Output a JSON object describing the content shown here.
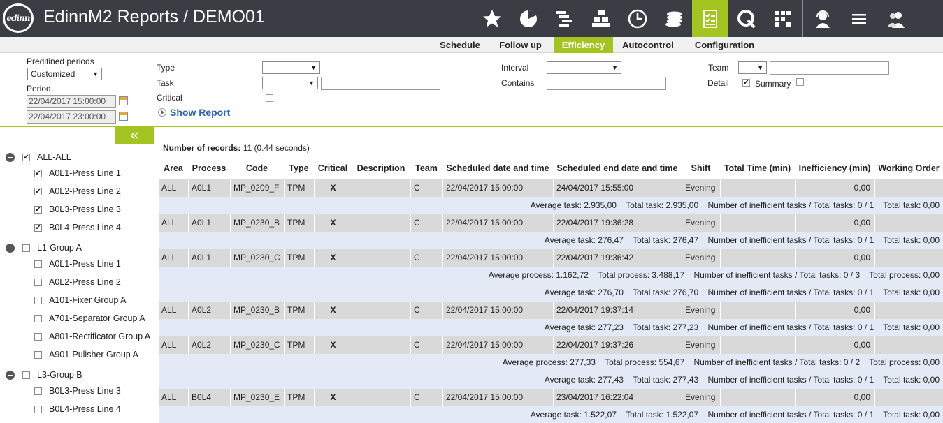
{
  "header": {
    "logo_text": "edinn",
    "title": "EdinnM2 Reports / DEMO01",
    "icons": [
      "star-icon",
      "pie-chart-icon",
      "gantt-icon",
      "stack-icon",
      "clock-icon",
      "coins-icon",
      "checklist-icon",
      "quality-q-icon",
      "grid-dots-icon",
      "support-agent-icon",
      "menu-icon",
      "users-icon"
    ],
    "active_icon": "checklist-icon",
    "accent_color": "#a4c520"
  },
  "tabs": [
    "Schedule",
    "Follow up",
    "Efficiency",
    "Autocontrol",
    "Configuration"
  ],
  "active_tab": "Efficiency",
  "filters": {
    "predefined_periods_label": "Predifined periods",
    "predefined_periods_value": "Customized",
    "period_label": "Period",
    "period_start": "22/04/2017 15:00:00",
    "period_end": "22/04/2017 23:00:00",
    "type_label": "Type",
    "task_label": "Task",
    "critical_label": "Critical",
    "interval_label": "Interval",
    "contains_label": "Contains",
    "team_label": "Team",
    "detail_label": "Detail",
    "summary_label": "Summary",
    "detail_checked": true,
    "summary_checked": false,
    "show_report": "Show Report"
  },
  "sidebar": {
    "collapse_glyph": "«",
    "tree": [
      {
        "label": "ALL-ALL",
        "level": 0,
        "checked": true,
        "group": true
      },
      {
        "label": "A0L1-Press Line 1",
        "level": 1,
        "checked": true
      },
      {
        "label": "A0L2-Press Line 2",
        "level": 1,
        "checked": true
      },
      {
        "label": "B0L3-Press Line 3",
        "level": 1,
        "checked": true
      },
      {
        "label": "B0L4-Press Line 4",
        "level": 1,
        "checked": true
      },
      {
        "label": "L1-Group A",
        "level": 0,
        "checked": false,
        "group": true
      },
      {
        "label": "A0L1-Press Line 1",
        "level": 1,
        "checked": false
      },
      {
        "label": "A0L2-Press Line 2",
        "level": 1,
        "checked": false
      },
      {
        "label": "A101-Fixer Group A",
        "level": 1,
        "checked": false
      },
      {
        "label": "A701-Separator Group A",
        "level": 1,
        "checked": false
      },
      {
        "label": "A801-Rectificator Group A",
        "level": 1,
        "checked": false
      },
      {
        "label": "A901-Pulisher Group A",
        "level": 1,
        "checked": false
      },
      {
        "label": "L3-Group B",
        "level": 0,
        "checked": false,
        "group": true
      },
      {
        "label": "B0L3-Press Line 3",
        "level": 1,
        "checked": false
      },
      {
        "label": "B0L4-Press Line 4",
        "level": 1,
        "checked": false
      }
    ]
  },
  "report": {
    "records_label": "Number of records:",
    "records_value": "11  (0.44 seconds)",
    "columns": [
      "Area",
      "Process",
      "Code",
      "Type",
      "Critical",
      "Description",
      "Team",
      "Scheduled date and time",
      "Scheduled end date and time",
      "Shift",
      "Total Time (min)",
      "Inefficiency (min)",
      "Working Order"
    ],
    "rows": [
      {
        "kind": "data",
        "cells": [
          "ALL",
          "A0L1",
          "MP_0209_F",
          "TPM",
          "X",
          "",
          "C",
          "22/04/2017 15:00:00",
          "24/04/2017 15:55:00",
          "Evening",
          "",
          "0,00",
          ""
        ]
      },
      {
        "kind": "summary",
        "text": "Average task: 2.935,00    Total task: 2.935,00    Number of inefficient tasks / Total tasks: 0 / 1    Total task: 0,00"
      },
      {
        "kind": "data",
        "cells": [
          "ALL",
          "A0L1",
          "MP_0230_B",
          "TPM",
          "X",
          "",
          "C",
          "22/04/2017 15:00:00",
          "22/04/2017 19:36:28",
          "Evening",
          "",
          "0,00",
          ""
        ]
      },
      {
        "kind": "summary",
        "text": "Average task: 276,47    Total task: 276,47    Number of inefficient tasks / Total tasks: 0 / 1    Total task: 0,00"
      },
      {
        "kind": "data",
        "cells": [
          "ALL",
          "A0L1",
          "MP_0230_C",
          "TPM",
          "X",
          "",
          "C",
          "22/04/2017 15:00:00",
          "22/04/2017 19:36:42",
          "Evening",
          "",
          "0,00",
          ""
        ]
      },
      {
        "kind": "summary",
        "text": "Average process: 1.162,72    Total process: 3.488,17    Number of inefficient tasks / Total tasks: 0 / 3    Total process: 0,00"
      },
      {
        "kind": "summary",
        "text": "Average task: 276,70    Total task: 276,70    Number of inefficient tasks / Total tasks: 0 / 1    Total task: 0,00"
      },
      {
        "kind": "data",
        "cells": [
          "ALL",
          "A0L2",
          "MP_0230_B",
          "TPM",
          "X",
          "",
          "C",
          "22/04/2017 15:00:00",
          "22/04/2017 19:37:14",
          "Evening",
          "",
          "0,00",
          ""
        ]
      },
      {
        "kind": "summary",
        "text": "Average task: 277,23    Total task: 277,23    Number of inefficient tasks / Total tasks: 0 / 1    Total task: 0,00"
      },
      {
        "kind": "data",
        "cells": [
          "ALL",
          "A0L2",
          "MP_0230_C",
          "TPM",
          "X",
          "",
          "C",
          "22/04/2017 15:00:00",
          "22/04/2017 19:37:26",
          "Evening",
          "",
          "0,00",
          ""
        ]
      },
      {
        "kind": "summary",
        "text": "Average process: 277,33    Total process: 554,67    Number of inefficient tasks / Total tasks: 0 / 2    Total process: 0,00"
      },
      {
        "kind": "summary",
        "text": "Average task: 277,43    Total task: 277,43    Number of inefficient tasks / Total tasks: 0 / 1    Total task: 0,00"
      },
      {
        "kind": "data",
        "cells": [
          "ALL",
          "B0L4",
          "MP_0230_E",
          "TPM",
          "X",
          "",
          "C",
          "22/04/2017 15:00:00",
          "23/04/2017 16:22:04",
          "Evening",
          "",
          "0,00",
          ""
        ]
      },
      {
        "kind": "summary",
        "text": "Average task: 1.522,07    Total task: 1.522,07    Number of inefficient tasks / Total tasks: 0 / 1    Total task: 0,00"
      }
    ]
  }
}
